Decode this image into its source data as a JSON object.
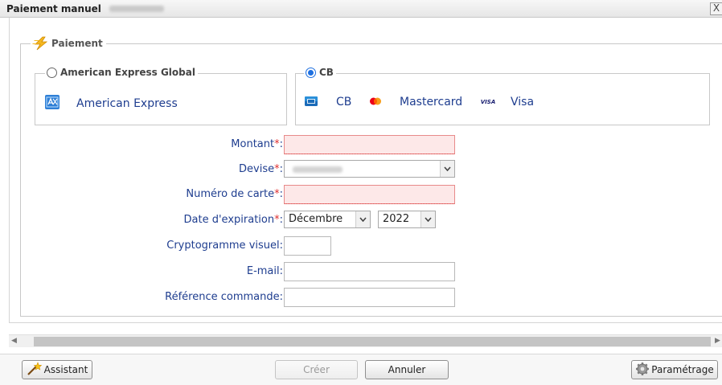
{
  "window": {
    "title": "Paiement manuel",
    "close_label": "X"
  },
  "fieldset": {
    "legend": "Paiement"
  },
  "payment_methods": [
    {
      "label": "American Express Global",
      "selected": false,
      "brands": [
        {
          "name": "American Express",
          "icon": "amex-card-icon"
        }
      ]
    },
    {
      "label": "CB",
      "selected": true,
      "brands": [
        {
          "name": "CB",
          "icon": "cb-card-icon"
        },
        {
          "name": "Mastercard",
          "icon": "mastercard-icon"
        },
        {
          "name": "Visa",
          "icon": "visa-icon"
        }
      ]
    }
  ],
  "form": {
    "amount_label": "Montant",
    "currency_label": "Devise",
    "card_number_label": "Numéro de carte",
    "expiry_label": "Date d'expiration",
    "cvv_label": "Cryptogramme visuel:",
    "email_label": "E-mail:",
    "order_ref_label": "Référence commande:",
    "required_marker": "*",
    "label_suffix": ":",
    "expiry_month": "Décembre",
    "expiry_year": "2022"
  },
  "footer": {
    "assistant_label": "Assistant",
    "create_label": "Créer",
    "cancel_label": "Annuler",
    "settings_label": "Paramétrage"
  },
  "colors": {
    "label_blue": "#1e3d8f",
    "required_red": "#e03030",
    "error_bg": "#fde8e8",
    "radio_blue": "#1d6fe0"
  }
}
